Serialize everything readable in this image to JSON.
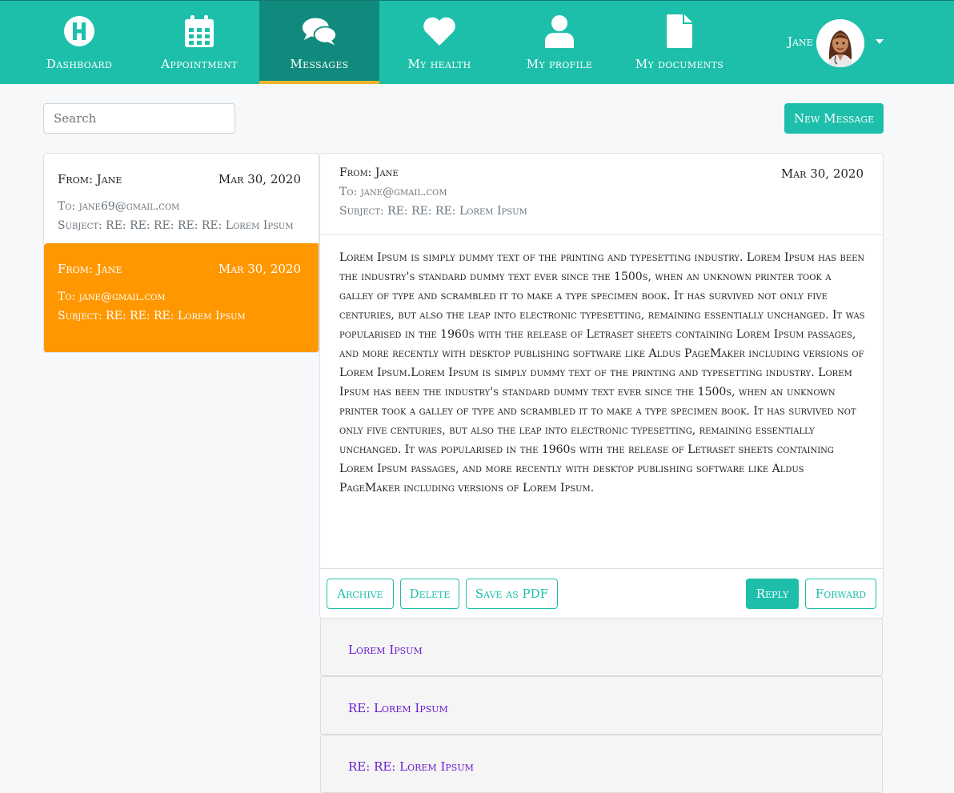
{
  "nav": {
    "items": [
      {
        "label": "Dashboard",
        "icon": "hospital-h-icon"
      },
      {
        "label": "Appointment",
        "icon": "calendar-icon"
      },
      {
        "label": "Messages",
        "icon": "chat-bubbles-icon"
      },
      {
        "label": "My health",
        "icon": "heart-icon"
      },
      {
        "label": "My profile",
        "icon": "user-icon"
      },
      {
        "label": "My documents",
        "icon": "document-icon"
      }
    ],
    "active": "Messages",
    "user_name": "Jane"
  },
  "colors": {
    "primary": "#1dbfab",
    "active_nav": "#108a7c",
    "active_underline": "#f0b429",
    "selected_message": "#ff9800",
    "thread_link": "#6a1bd0"
  },
  "search": {
    "placeholder": "Search"
  },
  "new_message_label": "New Message",
  "messages": [
    {
      "from": "From: Jane",
      "date": "Mar 30, 2020",
      "to": "To: jane69@gmail.com",
      "subject": "Subject: RE: RE: RE: RE: RE: Lorem Ipsum",
      "selected": false
    },
    {
      "from": "From: Jane",
      "date": "Mar 30, 2020",
      "to": "To: jane@gmail.com",
      "subject": "Subject: RE: RE: RE: Lorem Ipsum",
      "selected": true
    }
  ],
  "reader": {
    "from": "From: Jane",
    "date": "Mar 30, 2020",
    "to": "To: jane@gmail.com",
    "subject": "Subject: RE: RE: RE: Lorem Ipsum",
    "body": "Lorem Ipsum is simply dummy text of the printing and typesetting industry. Lorem Ipsum has been the industry's standard dummy text ever since the 1500s, when an unknown printer took a galley of type and scrambled it to make a type specimen book. It has survived not only five centuries, but also the leap into electronic typesetting, remaining essentially unchanged. It was popularised in the 1960s with the release of Letraset sheets containing Lorem Ipsum passages, and more recently with desktop publishing software like Aldus PageMaker including versions of Lorem Ipsum.Lorem Ipsum is simply dummy text of the printing and typesetting industry. Lorem Ipsum has been the industry's standard dummy text ever since the 1500s, when an unknown printer took a galley of type and scrambled it to make a type specimen book. It has survived not only five centuries, but also the leap into electronic typesetting, remaining essentially unchanged. It was popularised in the 1960s with the release of Letraset sheets containing Lorem Ipsum passages, and more recently with desktop publishing software like Aldus PageMaker including versions of Lorem Ipsum.",
    "actions": {
      "archive": "Archive",
      "delete": "Delete",
      "save_pdf": "Save as PDF",
      "reply": "Reply",
      "forward": "Forward"
    }
  },
  "thread": [
    "Lorem Ipsum",
    "RE: Lorem Ipsum",
    "RE: RE: Lorem Ipsum"
  ]
}
